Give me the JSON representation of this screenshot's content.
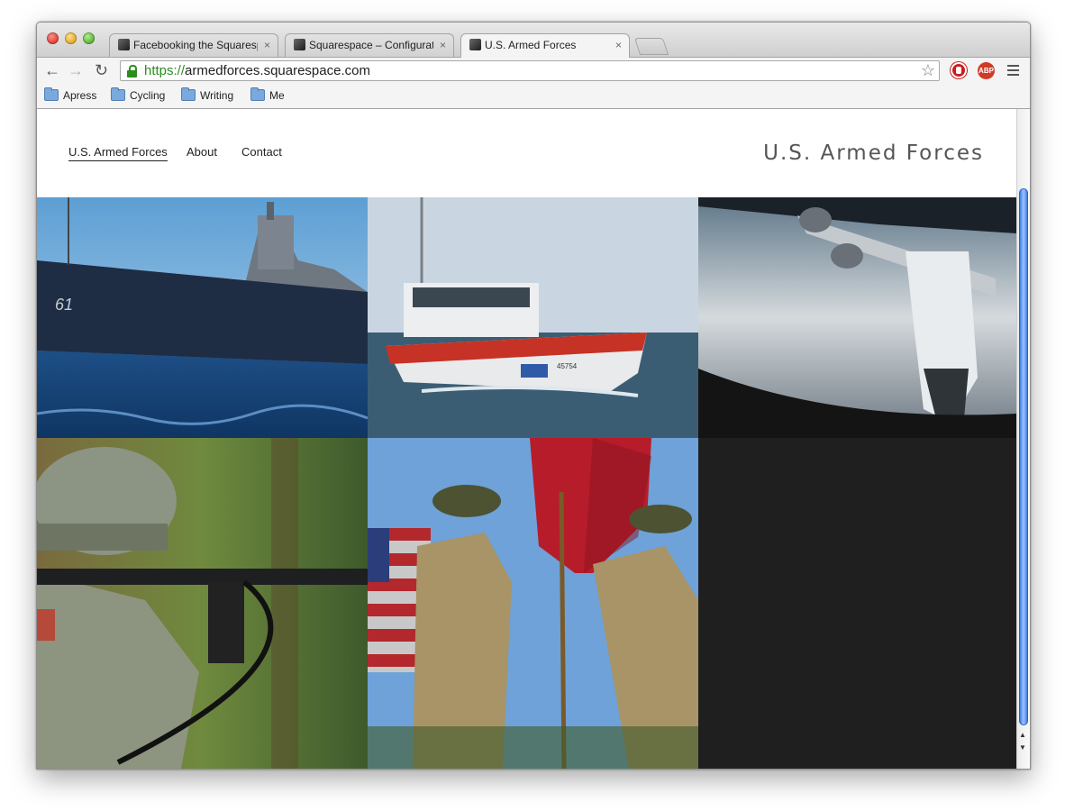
{
  "browser": {
    "tabs": [
      {
        "title": "Facebooking the Squarespace",
        "active": false
      },
      {
        "title": "Squarespace – Configuration",
        "active": false
      },
      {
        "title": "U.S. Armed Forces",
        "active": true
      }
    ],
    "url_scheme": "https://",
    "url_host": "armedforces.squarespace.com",
    "bookmarks": [
      "Apress",
      "Cycling",
      "Writing",
      "Me"
    ],
    "close_glyph": "×"
  },
  "site": {
    "nav": [
      "U.S. Armed Forces",
      "About",
      "Contact"
    ],
    "current": "U.S. Armed Forces",
    "title": "U.S. Armed Forces"
  },
  "gallery": [
    {
      "subject": "battleship"
    },
    {
      "subject": "coast-guard-boat"
    },
    {
      "subject": "aircraft-refueling"
    },
    {
      "subject": "soldier-with-rifle"
    },
    {
      "subject": "marine-flag-ceremony"
    },
    {
      "subject": "empty"
    }
  ],
  "colors": {
    "secure_green": "#2a8d1d",
    "empty_tile": "#1f1f1f"
  }
}
